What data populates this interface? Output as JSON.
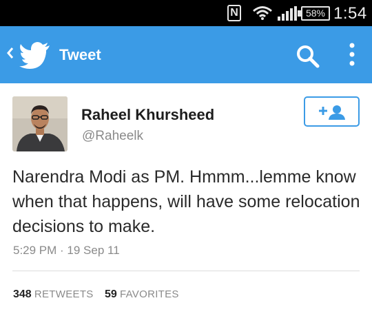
{
  "status_bar": {
    "nfc_label": "N",
    "battery": "58%",
    "time": "1:54"
  },
  "app_bar": {
    "title": "Tweet",
    "icons": [
      "back-chevron-icon",
      "twitter-bird-icon",
      "search-icon",
      "overflow-menu-icon"
    ],
    "color": "#3b9be6"
  },
  "tweet": {
    "display_name": "Raheel Khursheed",
    "handle": "@Raheelk",
    "text": "Narendra Modi as PM. Hmmm...lemme know when that happens, will have some relocation decisions to make.",
    "timestamp": "5:29 PM · 19 Sep 11",
    "follow_icon": "follow-user-icon",
    "stats": {
      "retweets_count": "348",
      "retweets_label": "RETWEETS",
      "favorites_count": "59",
      "favorites_label": "FAVORITES"
    }
  }
}
